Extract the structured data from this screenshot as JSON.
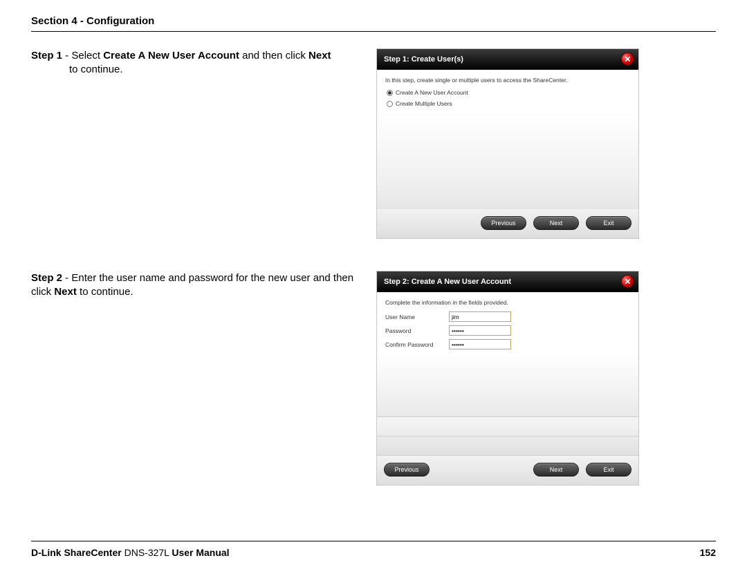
{
  "header": {
    "section": "Section 4 - Configuration"
  },
  "steps": {
    "s1": {
      "label": "Step 1",
      "dash": " - ",
      "pre": "Select ",
      "bold1": "Create A New User Account",
      "mid": " and then click ",
      "bold2": "Next",
      "post": " to continue."
    },
    "s2": {
      "label": "Step 2",
      "dash": " - ",
      "pre": "Enter the user name and password for the new user and then click ",
      "bold1": "Next",
      "post": " to continue."
    }
  },
  "dialog1": {
    "title": "Step 1: Create User(s)",
    "hint": "In this step, create single or multiple users to access the ShareCenter.",
    "opt1": "Create A New User Account",
    "opt2": "Create Multiple Users",
    "btn_prev": "Previous",
    "btn_next": "Next",
    "btn_exit": "Exit"
  },
  "dialog2": {
    "title": "Step 2: Create A New User Account",
    "hint": "Complete the information in the fields provided.",
    "label_user": "User Name",
    "label_pw": "Password",
    "label_cpw": "Confirm Password",
    "val_user": "jim",
    "val_pw": "••••••",
    "val_cpw": "••••••",
    "btn_prev": "Previous",
    "btn_next": "Next",
    "btn_exit": "Exit"
  },
  "footer": {
    "brand_bold1": "D-Link ShareCenter",
    "model": " DNS-327L ",
    "brand_bold2": "User Manual",
    "page": "152"
  }
}
